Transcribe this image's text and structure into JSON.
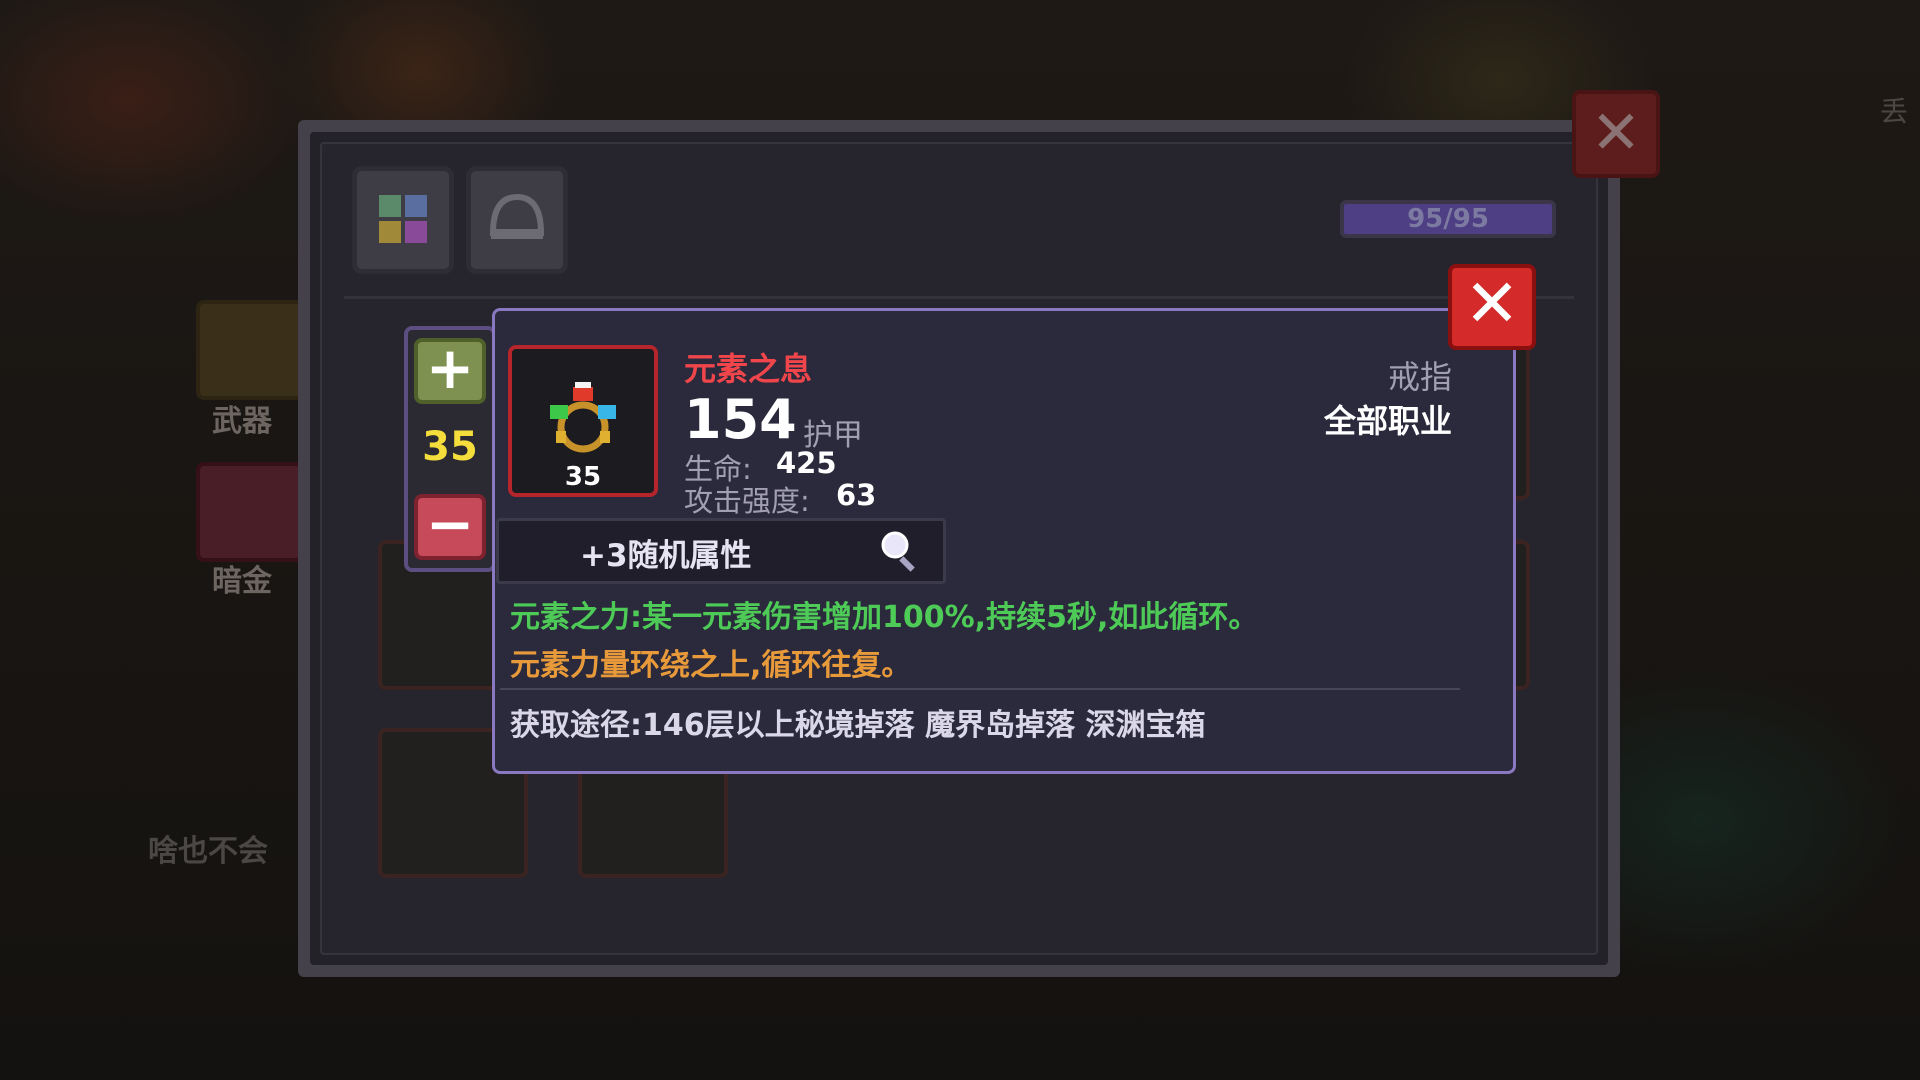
{
  "background": {
    "left_tabs": [
      "武器",
      "暗金"
    ],
    "bottom_label": "啥也不会",
    "right_fragment": "丢"
  },
  "window": {
    "close_glyph": "✕",
    "capacity": {
      "text": "95/95",
      "fill_fraction": 1.0
    }
  },
  "stepper": {
    "plus": "+",
    "level": "35",
    "minus": "−"
  },
  "item": {
    "name": "元素之息",
    "icon_level": "35",
    "armor_value": "154",
    "armor_label": "护甲",
    "hp_label": "生命:",
    "hp_value": "425",
    "atk_label": "攻击强度:",
    "atk_value": "63",
    "type": "戒指",
    "class": "全部职业",
    "random_attrs": "+3随机属性",
    "passive": "元素之力:某一元素伤害增加100%,持续5秒,如此循环。",
    "flavor": "元素力量环绕之上,循环往复。",
    "source": "获取途径:146层以上秘境掉落 魔界岛掉落 深渊宝箱",
    "close_glyph": "✕"
  },
  "colors": {
    "item_name": "#f0464b",
    "passive": "#4ecb57",
    "flavor": "#e89a3a",
    "level": "#f5de3c",
    "card_border": "#8a78c0"
  }
}
